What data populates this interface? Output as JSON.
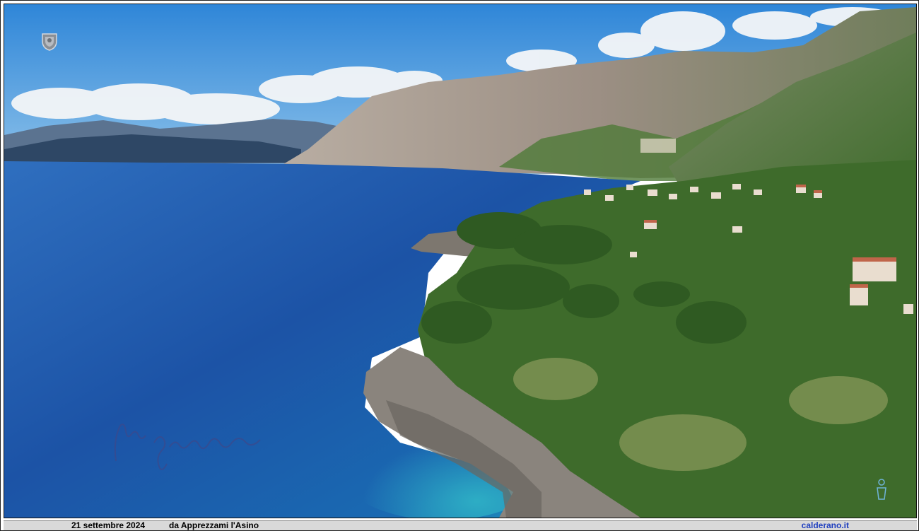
{
  "caption": {
    "date": "21 settembre 2024",
    "source": "da Apprezzami l'Asino",
    "site": "calderano.it"
  },
  "colors": {
    "sky": "#3f92dc",
    "sea_deep": "#1b4fa2",
    "sea_shallow": "#2a9fc0",
    "vegetation": "#3f6f2a",
    "cliff": "#a99c8e",
    "caption_bar": "#d9d9d9",
    "site_link": "#1f3fbf"
  },
  "icons": {
    "seal": "coat-of-arms-icon",
    "signature": "handwritten-signature",
    "corner": "small-figure-watermark-icon"
  }
}
